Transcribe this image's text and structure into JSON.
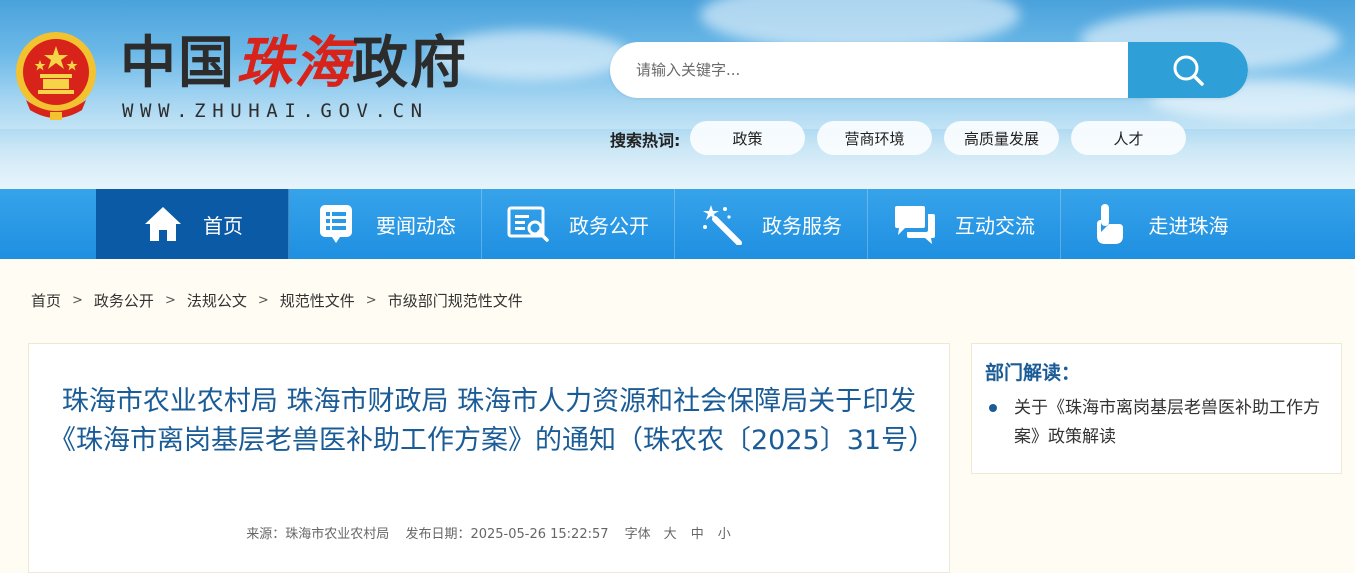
{
  "header": {
    "site_name_pre": "中国",
    "site_name_red": "珠海",
    "site_name_post": "政府",
    "site_url": "WWW.ZHUHAI.GOV.CN",
    "search_placeholder": "请输入关键字...",
    "hot_label": "搜索热词:",
    "hot_tags": [
      "政策",
      "营商环境",
      "高质量发展",
      "人才"
    ]
  },
  "nav": {
    "items": [
      {
        "label": "首页",
        "icon": "home-icon",
        "active": true
      },
      {
        "label": "要闻动态",
        "icon": "news-list-icon"
      },
      {
        "label": "政务公开",
        "icon": "document-search-icon"
      },
      {
        "label": "政务服务",
        "icon": "magic-wand-icon"
      },
      {
        "label": "互动交流",
        "icon": "chat-bubble-icon"
      },
      {
        "label": "走进珠海",
        "icon": "pointer-hand-icon"
      }
    ]
  },
  "breadcrumb": [
    "首页",
    "政务公开",
    "法规公文",
    "规范性文件",
    "市级部门规范性文件"
  ],
  "article": {
    "title": "珠海市农业农村局 珠海市财政局 珠海市人力资源和社会保障局关于印发《珠海市离岗基层老兽医补助工作方案》的通知（珠农农〔2025〕31号）",
    "source": "来源：珠海市农业农村局",
    "date": "发布日期：2025-05-26 15:22:57",
    "font_label": "字体",
    "font_large": "大",
    "font_medium": "中",
    "font_small": "小"
  },
  "side": {
    "title": "部门解读：",
    "item": "关于《珠海市离岗基层老兽医补助工作方案》政策解读"
  },
  "colors": {
    "nav_bg": "#2a9ae6",
    "nav_active": "#0b5aa6",
    "title_blue": "#1b5c97",
    "search_btn": "#2f9fd8"
  }
}
